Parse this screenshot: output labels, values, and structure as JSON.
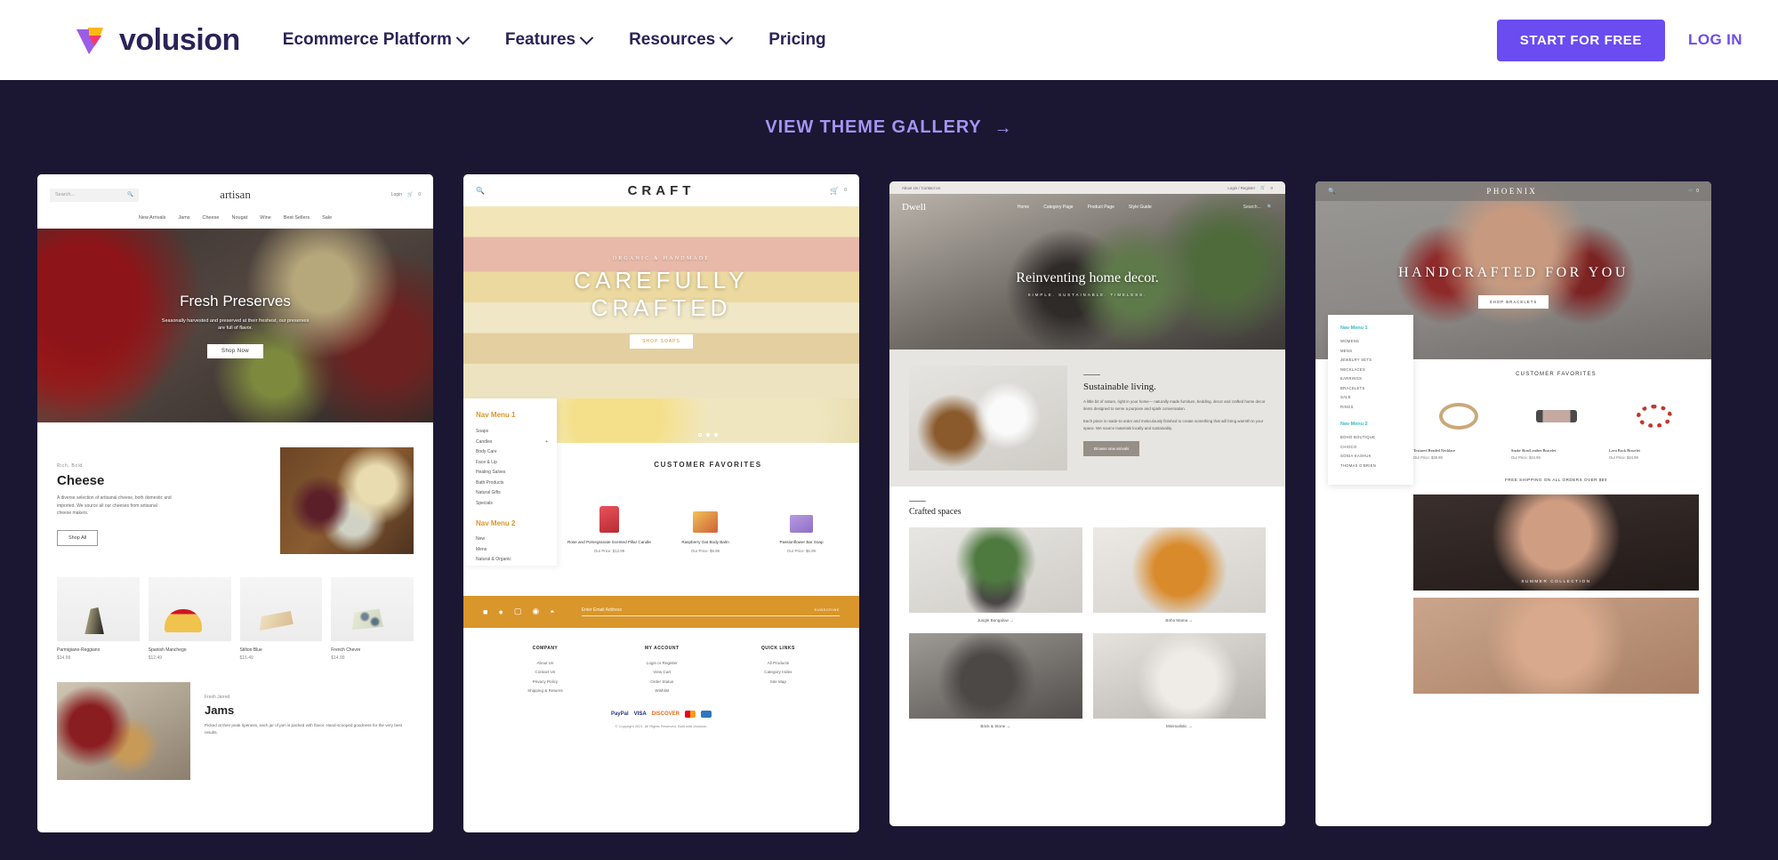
{
  "header": {
    "logo_text": "volusion",
    "logo_icon": "volusion-v-logo",
    "nav": [
      {
        "label": "Ecommerce Platform",
        "has_dropdown": true
      },
      {
        "label": "Features",
        "has_dropdown": true
      },
      {
        "label": "Resources",
        "has_dropdown": true
      },
      {
        "label": "Pricing",
        "has_dropdown": false
      }
    ],
    "cta_label": "START FOR FREE",
    "login_label": "LOG IN",
    "accent_color": "#6A4CF0"
  },
  "hero_section": {
    "gallery_link_label": "VIEW THEME GALLERY",
    "gallery_link_arrow": "→",
    "background_color": "#1b1632",
    "link_color": "#A494F2"
  },
  "themes": [
    {
      "id": "artisan",
      "brand": "artisan",
      "search_placeholder": "Search...",
      "account": "Login",
      "cart_count": "0",
      "nav": [
        "New Arrivals",
        "Jams",
        "Cheese",
        "Nougat",
        "Wine",
        "Best Sellers",
        "Sale"
      ],
      "hero_title": "Fresh Preserves",
      "hero_sub": "Seasonally harvested and preserved at their freshest, our preserves are full of flavor.",
      "hero_cta": "Shop Now",
      "feature_eyebrow": "Rich, Bold",
      "feature_title": "Cheese",
      "feature_body": "A diverse selection of artisanal cheese, both domestic and imported. We source all our cheeses from artisanal cheese makers.",
      "feature_cta": "Shop All",
      "products": [
        {
          "name": "Parmigiano-Reggiano",
          "price": "$14.99"
        },
        {
          "name": "Spanish Manchego",
          "price": "$12.49"
        },
        {
          "name": "Stilton Blue",
          "price": "$16.49"
        },
        {
          "name": "French Chevre",
          "price": "$14.99"
        }
      ],
      "feature2_eyebrow": "Fresh Jarred",
      "feature2_title": "Jams",
      "feature2_body": "Picked at their peak ripeness, each jar of jam is packed with flavor. Hand-scooped goodness for the very best results."
    },
    {
      "id": "craft",
      "brand": "CRAFT",
      "cart_count": "0",
      "hero_eyebrow": "ORGANIC & HANDMADE",
      "hero_title_1": "CAREFULLY",
      "hero_title_2": "CRAFTED",
      "hero_cta": "SHOP SOAPS",
      "nav_menu_1_title": "Nav Menu 1",
      "nav_menu_1": [
        "Soaps",
        "Candles",
        "Body Care",
        "Face & Lip",
        "Healing Salves",
        "Bath Products",
        "Natural Gifts",
        "Specials"
      ],
      "nav_menu_2_title": "Nav Menu 2",
      "nav_menu_2": [
        "New",
        "Mens",
        "Natural & Organic"
      ],
      "section_title": "CUSTOMER FAVORITES",
      "products": [
        {
          "name": "Rose and Pomegranate Scented Pillar Candle",
          "price": "Our Price: $12.99"
        },
        {
          "name": "Raspberry Oat Body Balm",
          "price": "Our Price: $9.99"
        },
        {
          "name": "Passionflower Bar Soap",
          "price": "Our Price: $6.99"
        }
      ],
      "newsletter_placeholder": "Enter Email Address",
      "newsletter_button": "SUBSCRIBE",
      "social_icons": [
        "facebook-icon",
        "twitter-icon",
        "instagram-icon",
        "pinterest-icon",
        "rss-icon"
      ],
      "footer_columns": [
        {
          "title": "COMPANY",
          "links": [
            "About Us",
            "Contact Us",
            "Privacy Policy",
            "Shipping & Returns"
          ]
        },
        {
          "title": "MY ACCOUNT",
          "links": [
            "Login or Register",
            "View Cart",
            "Order Status",
            "Wishlist"
          ]
        },
        {
          "title": "QUICK LINKS",
          "links": [
            "All Products",
            "Category Index",
            "Site Map"
          ]
        }
      ],
      "payment_icons": [
        "PayPal",
        "VISA",
        "DISCOVER",
        "mastercard",
        "amex"
      ],
      "copyright": "© Copyright 2021. All Rights Reserved. Built with Volusion.",
      "accent_color": "#D9962B"
    },
    {
      "id": "dwell",
      "brand": "Dwell",
      "utility_links": "About Us / Contact Us",
      "account": "Login / Register",
      "cart_count": "0",
      "search_placeholder": "Search...",
      "nav": [
        "Home",
        "Category Page",
        "Product Page",
        "Style Guide"
      ],
      "hero_title": "Reinventing home decor.",
      "hero_sub": "SIMPLE. SUSTAINABLE. TIMELESS.",
      "feature_title": "Sustainable living.",
      "feature_body_1": "A little bit of nature, right in your home— naturally made furniture, bedding, decor and crafted home decor items designed to serve a purpose and spark conversation.",
      "feature_body_2": "Each piece is made-to-order and meticulously finished to create something that will bring warmth to your space. We source materials locally and sustainably.",
      "feature_cta": "Browse new arrivals",
      "section_title": "Crafted spaces",
      "collections": [
        {
          "name": "Jungle Bungalow",
          "arrow": "→"
        },
        {
          "name": "Boho Mama",
          "arrow": "→"
        },
        {
          "name": "Brick & Stone",
          "arrow": "→"
        },
        {
          "name": "Minimalistic",
          "arrow": "→"
        }
      ]
    },
    {
      "id": "phoenix",
      "brand": "PHOENIX",
      "cart_count": "0",
      "hero_title": "HANDCRAFTED FOR YOU",
      "hero_cta": "SHOP BRACELETS",
      "nav_menu_1_title": "Nav Menu 1",
      "nav_menu_1": [
        "WOMENS",
        "MENS",
        "JEWELRY SETS",
        "NECKLACES",
        "EARRINGS",
        "BRACELETS",
        "SALE",
        "RINGS"
      ],
      "nav_menu_2_title": "Nav Menu 2",
      "nav_menu_2": [
        "BOHO BOUTIQUE",
        "CHIOCO",
        "SONIA KASHUK",
        "THOMAS O'BRIEN"
      ],
      "section_title": "CUSTOMER FAVORITES",
      "products": [
        {
          "name": "Textured Beaded Necklace",
          "price": "Our Price: $28.99"
        },
        {
          "name": "Snake Skin/Leather Bracelet",
          "price": "Our Price: $24.99"
        },
        {
          "name": "Lava Rock Bracelet",
          "price": "Our Price: $24.99"
        }
      ],
      "promo": "FREE SHIPPING ON ALL ORDERS OVER $80",
      "banner_caption": "SUMMER COLLECTION"
    }
  ]
}
